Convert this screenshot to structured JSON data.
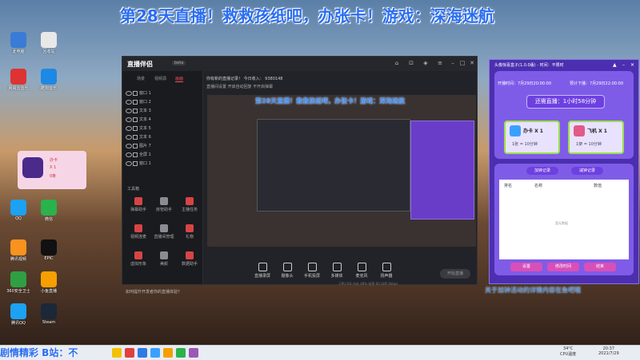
{
  "banner": "第28天直播！救救孩纸吧，办张卡！游戏：深海迷航",
  "desktop": {
    "icons": [
      {
        "label": "此电脑",
        "color": "#3a7bd5"
      },
      {
        "label": "回收站",
        "color": "#e8e8e8"
      },
      {
        "label": "网易云音乐",
        "color": "#d33"
      },
      {
        "label": "酷狗音乐",
        "color": "#1e88e5"
      },
      {
        "label": "QQ",
        "color": "#1da1f2"
      },
      {
        "label": "微信",
        "color": "#2ab24b"
      },
      {
        "label": "腾讯视频",
        "color": "#f7931e"
      },
      {
        "label": "EPIC",
        "color": "#111"
      },
      {
        "label": "360安全卫士",
        "color": "#2ea043"
      },
      {
        "label": "小鱼直播",
        "color": "#f59f00"
      },
      {
        "label": "腾讯QQ",
        "color": "#1da1f2"
      },
      {
        "label": "Steam",
        "color": "#1b2838"
      }
    ],
    "widget": {
      "l1": "办卡",
      "l2": "X 1",
      "l3": "0条"
    }
  },
  "app": {
    "logo": "直播伴侣",
    "version": "beta",
    "tabs": [
      "场景",
      "视频源",
      "画面"
    ],
    "sources": [
      "窗口 1",
      "窗口 2",
      "文本 3",
      "文本 4",
      "文本 5",
      "文本 6",
      "图片 7",
      "全屏 1",
      "窗口 1"
    ],
    "tools_label": "工具箱",
    "tools": [
      "弹幕助手",
      "房管助手",
      "主播任务",
      "视频连麦",
      "直播间管理",
      "礼物",
      "虚拟形象",
      "美颜",
      "数据助手"
    ],
    "hint": "如何提升开发者你的直播体验？",
    "room_info": "你有新的直播记录！  今日收入：  9380148",
    "room_info2": "直播间设置   开启自动回复   不开启弹幕",
    "preview_banner": "第28天直播！救救孩纸吧，办张卡！游戏：深海迷航",
    "bottom_buttons": [
      "直播录屏",
      "摄像头",
      "手机投屏",
      "多媒体",
      "麦克风",
      "扬声器"
    ],
    "start_label": "开始直播",
    "perf": "CPU 6%  内存 48%  帧率 60  码率 0kbps"
  },
  "panel": {
    "title": "头像惊喜盒子(1.0.0版)  - 时间：不限时",
    "start_time": "开播时间：7月29日20:00:00",
    "end_time": "预计下播：7月29日22:00:00",
    "remaining": "还需直播：1小时58分钟",
    "cards": [
      {
        "name": "办卡 X 1",
        "sub": "1张 = 10分钟",
        "color": "#3aa0ff"
      },
      {
        "name": "飞机 X 1",
        "sub": "1架 = 10分钟",
        "color": "#e25a88"
      }
    ],
    "tabs": [
      "加钟记录",
      "减钟记录"
    ],
    "columns": [
      "排名",
      "名称",
      "数值"
    ],
    "empty": "暂无数据",
    "buttons": [
      "设置",
      "修改时间",
      "结束"
    ]
  },
  "notice": "关于加钟活动的详情内容在鱼吧哦",
  "taskbar": {
    "ticker": "剧情精彩 B站：不",
    "temp": "34°C",
    "cpu": "CPU温度",
    "time": "20:37",
    "date": "2021/7/29"
  }
}
